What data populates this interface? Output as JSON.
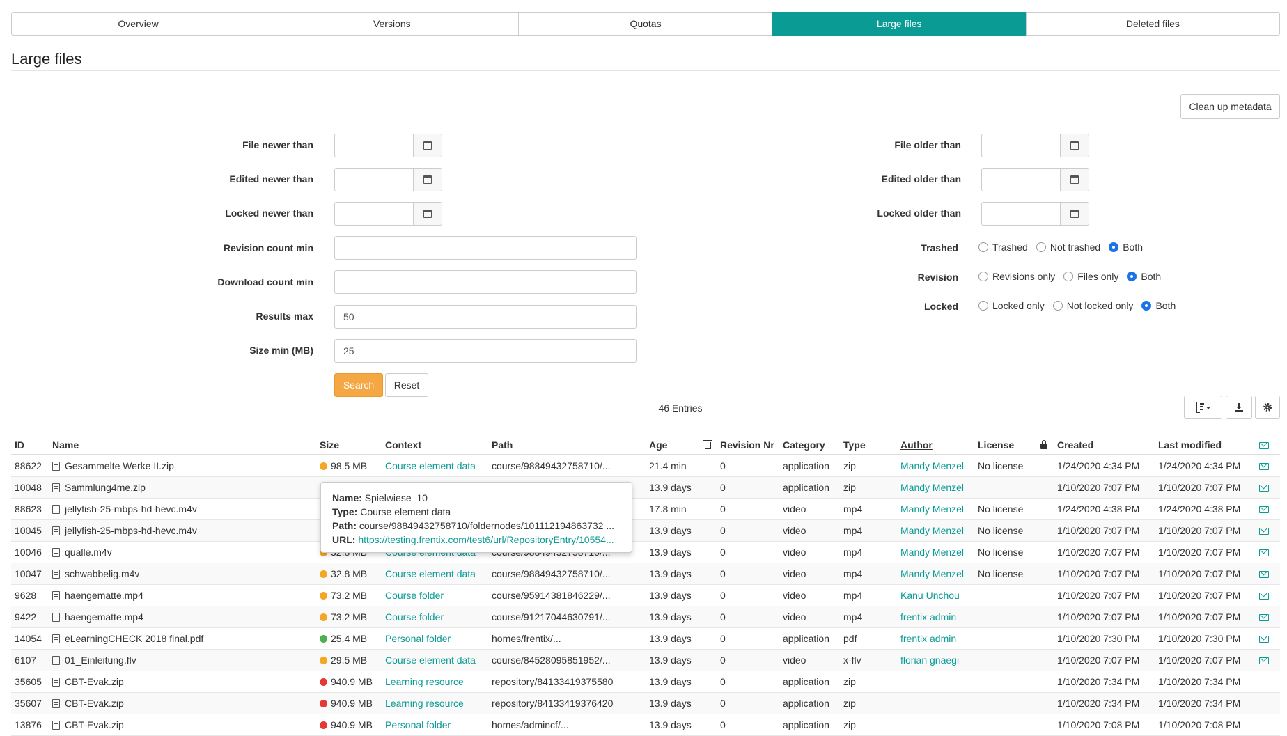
{
  "tabs": [
    {
      "label": "Overview",
      "active": false
    },
    {
      "label": "Versions",
      "active": false
    },
    {
      "label": "Quotas",
      "active": false
    },
    {
      "label": "Large files",
      "active": true
    },
    {
      "label": "Deleted files",
      "active": false
    }
  ],
  "page_title": "Large files",
  "cleanup_label": "Clean up metadata",
  "form": {
    "file_newer": "File newer than",
    "edited_newer": "Edited newer than",
    "locked_newer": "Locked newer than",
    "revision_count_min": "Revision count min",
    "download_count_min": "Download count min",
    "results_max": "Results max",
    "results_max_value": "50",
    "size_min": "Size min (MB)",
    "size_min_value": "25",
    "file_older": "File older than",
    "edited_older": "Edited older than",
    "locked_older": "Locked older than",
    "trashed": "Trashed",
    "trashed_opts": [
      "Trashed",
      "Not trashed",
      "Both"
    ],
    "revision": "Revision",
    "revision_opts": [
      "Revisions only",
      "Files only",
      "Both"
    ],
    "locked": "Locked",
    "locked_opts": [
      "Locked only",
      "Not locked only",
      "Both"
    ],
    "search": "Search",
    "reset": "Reset"
  },
  "entries": "46 Entries",
  "colors": {
    "accent": "#0a9b95",
    "search": "#f4a742",
    "dot_orange": "#f5a623",
    "dot_green": "#4caf50",
    "dot_red": "#e53935"
  },
  "table": {
    "headers": {
      "id": "ID",
      "name": "Name",
      "size": "Size",
      "context": "Context",
      "path": "Path",
      "age": "Age",
      "revision": "Revision Nr",
      "category": "Category",
      "type": "Type",
      "author": "Author",
      "license": "License",
      "created": "Created",
      "modified": "Last modified"
    },
    "rows": [
      {
        "id": "88622",
        "name": "Gesammelte Werke II.zip",
        "dot": "orange",
        "size": "98.5 MB",
        "context": "Course element data",
        "path": "course/98849432758710/...",
        "age": "21.4 min",
        "rev": "0",
        "category": "application",
        "type": "zip",
        "author": "Mandy Menzel",
        "license": "No license",
        "created": "1/24/2020 4:34 PM",
        "modified": "1/24/2020 4:34 PM"
      },
      {
        "id": "10048",
        "name": "Sammlung4me.zip",
        "dot": "orange",
        "size": "",
        "context": "",
        "path": "",
        "age": "13.9 days",
        "rev": "0",
        "category": "application",
        "type": "zip",
        "author": "Mandy Menzel",
        "license": "",
        "created": "1/10/2020 7:07 PM",
        "modified": "1/10/2020 7:07 PM"
      },
      {
        "id": "88623",
        "name": "jellyfish-25-mbps-hd-hevc.m4v",
        "dot": "orange",
        "size": "",
        "context": "",
        "path": "",
        "age": "17.8 min",
        "rev": "0",
        "category": "video",
        "type": "mp4",
        "author": "Mandy Menzel",
        "license": "No license",
        "created": "1/24/2020 4:38 PM",
        "modified": "1/24/2020 4:38 PM"
      },
      {
        "id": "10045",
        "name": "jellyfish-25-mbps-hd-hevc.m4v",
        "dot": "orange",
        "size": "",
        "context": "",
        "path": "",
        "age": "13.9 days",
        "rev": "0",
        "category": "video",
        "type": "mp4",
        "author": "Mandy Menzel",
        "license": "No license",
        "created": "1/10/2020 7:07 PM",
        "modified": "1/10/2020 7:07 PM"
      },
      {
        "id": "10046",
        "name": "qualle.m4v",
        "dot": "orange",
        "size": "32.8 MB",
        "context": "Course element data",
        "path": "course/98849432758710/...",
        "age": "13.9 days",
        "rev": "0",
        "category": "video",
        "type": "mp4",
        "author": "Mandy Menzel",
        "license": "No license",
        "created": "1/10/2020 7:07 PM",
        "modified": "1/10/2020 7:07 PM"
      },
      {
        "id": "10047",
        "name": "schwabbelig.m4v",
        "dot": "orange",
        "size": "32.8 MB",
        "context": "Course element data",
        "path": "course/98849432758710/...",
        "age": "13.9 days",
        "rev": "0",
        "category": "video",
        "type": "mp4",
        "author": "Mandy Menzel",
        "license": "No license",
        "created": "1/10/2020 7:07 PM",
        "modified": "1/10/2020 7:07 PM"
      },
      {
        "id": "9628",
        "name": "haengematte.mp4",
        "dot": "orange",
        "size": "73.2 MB",
        "context": "Course folder",
        "path": "course/95914381846229/...",
        "age": "13.9 days",
        "rev": "0",
        "category": "video",
        "type": "mp4",
        "author": "Kanu Unchou",
        "license": "",
        "created": "1/10/2020 7:07 PM",
        "modified": "1/10/2020 7:07 PM"
      },
      {
        "id": "9422",
        "name": "haengematte.mp4",
        "dot": "orange",
        "size": "73.2 MB",
        "context": "Course folder",
        "path": "course/91217044630791/...",
        "age": "13.9 days",
        "rev": "0",
        "category": "video",
        "type": "mp4",
        "author": "frentix admin",
        "license": "",
        "created": "1/10/2020 7:07 PM",
        "modified": "1/10/2020 7:07 PM"
      },
      {
        "id": "14054",
        "name": "eLearningCHECK 2018 final.pdf",
        "dot": "green",
        "size": "25.4 MB",
        "context": "Personal folder",
        "path": "homes/frentix/...",
        "age": "13.9 days",
        "rev": "0",
        "category": "application",
        "type": "pdf",
        "author": "frentix admin",
        "license": "",
        "created": "1/10/2020 7:30 PM",
        "modified": "1/10/2020 7:30 PM"
      },
      {
        "id": "6107",
        "name": "01_Einleitung.flv",
        "dot": "orange",
        "size": "29.5 MB",
        "context": "Course element data",
        "path": "course/84528095851952/...",
        "age": "13.9 days",
        "rev": "0",
        "category": "video",
        "type": "x-flv",
        "author": "florian gnaegi",
        "license": "",
        "created": "1/10/2020 7:07 PM",
        "modified": "1/10/2020 7:07 PM"
      },
      {
        "id": "35605",
        "name": "CBT-Evak.zip",
        "dot": "red",
        "size": "940.9 MB",
        "context": "Learning resource",
        "path": "repository/84133419375580",
        "age": "13.9 days",
        "rev": "0",
        "category": "application",
        "type": "zip",
        "author": "",
        "license": "",
        "created": "1/10/2020 7:34 PM",
        "modified": "1/10/2020 7:34 PM"
      },
      {
        "id": "35607",
        "name": "CBT-Evak.zip",
        "dot": "red",
        "size": "940.9 MB",
        "context": "Learning resource",
        "path": "repository/84133419376420",
        "age": "13.9 days",
        "rev": "0",
        "category": "application",
        "type": "zip",
        "author": "",
        "license": "",
        "created": "1/10/2020 7:34 PM",
        "modified": "1/10/2020 7:34 PM"
      },
      {
        "id": "13876",
        "name": "CBT-Evak.zip",
        "dot": "red",
        "size": "940.9 MB",
        "context": "Personal folder",
        "path": "homes/admincf/...",
        "age": "13.9 days",
        "rev": "0",
        "category": "application",
        "type": "zip",
        "author": "",
        "license": "",
        "created": "1/10/2020 7:08 PM",
        "modified": "1/10/2020 7:08 PM"
      }
    ]
  },
  "tooltip": {
    "name_label": "Name:",
    "name": "Spielwiese_10",
    "type_label": "Type:",
    "type": "Course element data",
    "path_label": "Path:",
    "path": "course/98849432758710/foldernodes/101112194863732 ...",
    "url_label": "URL:",
    "url": "https://testing.frentix.com/test6/url/RepositoryEntry/10554..."
  }
}
